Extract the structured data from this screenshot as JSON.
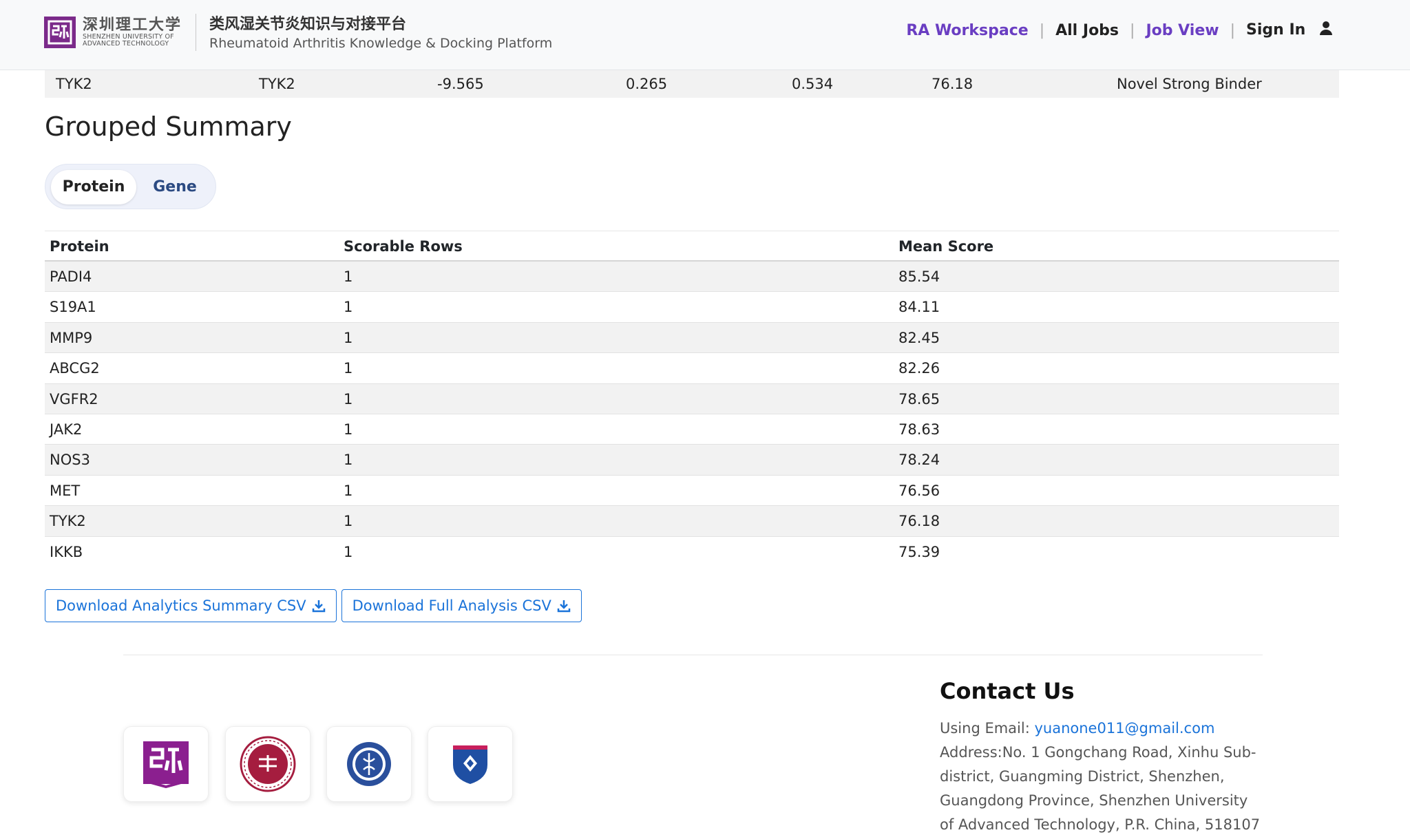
{
  "header": {
    "university_cn": "深圳理工大学",
    "university_en_1": "SHENZHEN UNIVERSITY OF",
    "university_en_2": "ADVANCED TECHNOLOGY",
    "platform_cn": "类风湿关节炎知识与对接平台",
    "platform_en": "Rheumatoid Arthritis Knowledge & Docking Platform",
    "nav": {
      "workspace": "RA Workspace",
      "all_jobs": "All Jobs",
      "job_view": "Job View",
      "sign_in": "Sign In",
      "separator": "|"
    }
  },
  "top_row": {
    "protein": "TYK2",
    "gene": "TYK2",
    "affinity": "-9.565",
    "val1": "0.265",
    "val2": "0.534",
    "score": "76.18",
    "label": "Novel Strong Binder"
  },
  "grouped_summary": {
    "title": "Grouped Summary",
    "tabs": {
      "protein": "Protein",
      "gene": "Gene"
    },
    "columns": {
      "protein": "Protein",
      "rows": "Scorable Rows",
      "mean": "Mean Score"
    },
    "rows": [
      {
        "protein": "PADI4",
        "rows": "1",
        "mean": "85.54"
      },
      {
        "protein": "S19A1",
        "rows": "1",
        "mean": "84.11"
      },
      {
        "protein": "MMP9",
        "rows": "1",
        "mean": "82.45"
      },
      {
        "protein": "ABCG2",
        "rows": "1",
        "mean": "82.26"
      },
      {
        "protein": "VGFR2",
        "rows": "1",
        "mean": "78.65"
      },
      {
        "protein": "JAK2",
        "rows": "1",
        "mean": "78.63"
      },
      {
        "protein": "NOS3",
        "rows": "1",
        "mean": "78.24"
      },
      {
        "protein": "MET",
        "rows": "1",
        "mean": "76.56"
      },
      {
        "protein": "TYK2",
        "rows": "1",
        "mean": "76.18"
      },
      {
        "protein": "IKKB",
        "rows": "1",
        "mean": "75.39"
      }
    ],
    "buttons": {
      "analytics": "Download Analytics Summary CSV",
      "full": "Download Full Analysis CSV"
    }
  },
  "footer": {
    "contact_title": "Contact Us",
    "email_label": "Using Email: ",
    "email": "yuanone011@gmail.com",
    "address_lines": [
      "Address:No. 1 Gongchang Road, Xinhu Sub-",
      "district, Guangming District, Shenzhen,",
      "Guangdong Province, Shenzhen University",
      "of Advanced Technology, P.R. China, 518107"
    ]
  },
  "colors": {
    "brand_purple": "#7b2a8a",
    "nav_purple": "#6a3ec2",
    "link_blue": "#1a73d9"
  }
}
